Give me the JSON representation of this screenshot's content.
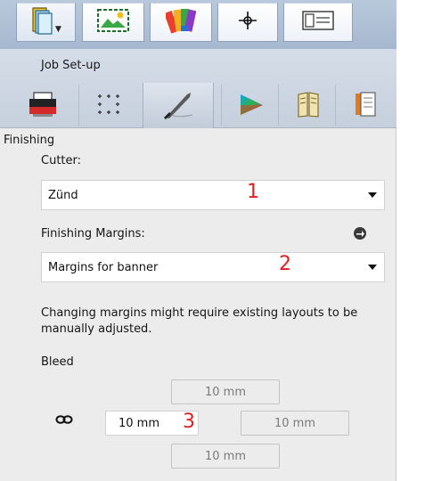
{
  "header": {
    "section_title": "Job Set-up"
  },
  "top_tabs": [
    {
      "icon": "document-dropdown-icon"
    },
    {
      "icon": "image-tile-icon"
    },
    {
      "icon": "color-palette-icon"
    },
    {
      "icon": "crosshair-icon"
    },
    {
      "icon": "layout-panel-icon"
    }
  ],
  "sub_tabs": [
    {
      "icon": "printer-icon"
    },
    {
      "icon": "grid-marks-icon"
    },
    {
      "icon": "knife-icon",
      "active": true
    },
    {
      "icon": "color-triangle-icon"
    },
    {
      "icon": "booklet-icon"
    },
    {
      "icon": "document-page-icon"
    }
  ],
  "finishing": {
    "title": "Finishing",
    "cutter_label": "Cutter:",
    "cutter_value": "Zünd",
    "cutter_callout": "1",
    "margins_label": "Finishing Margins:",
    "margins_value": "Margins for banner",
    "margins_callout": "2",
    "note": "Changing margins might require existing layouts to be manually adjusted."
  },
  "bleed": {
    "label": "Bleed",
    "top": "10 mm",
    "left": "10 mm",
    "right": "10 mm",
    "bottom": "10 mm",
    "callout": "3"
  },
  "colors": {
    "callout": "#e02020",
    "toolbar": "#a6b8cf"
  }
}
